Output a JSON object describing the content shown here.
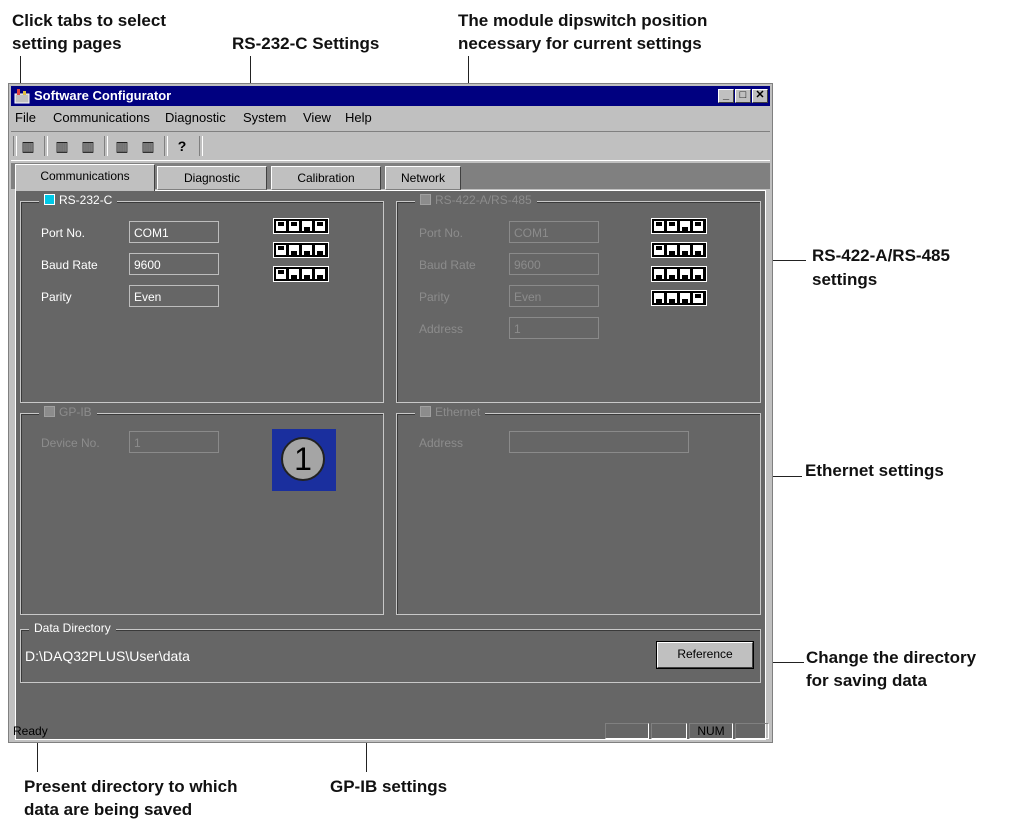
{
  "callouts": {
    "tabs_line1": "Click tabs to select",
    "tabs_line2": "setting pages",
    "rs232": "RS-232-C Settings",
    "dip_line1": "The module dipswitch position",
    "dip_line2": "necessary for current settings",
    "rs422_line1": "RS-422-A/RS-485",
    "rs422_line2": "settings",
    "ethernet": "Ethernet settings",
    "dir_line1": "Change the directory",
    "dir_line2": "for saving data",
    "present_line1": "Present directory to which",
    "present_line2": "data are being saved",
    "gpib": "GP-IB settings"
  },
  "window": {
    "title": "Software Configurator",
    "controls": {
      "minimize": "_",
      "maximize": "□",
      "close": "✕"
    }
  },
  "menu": [
    "File",
    "Communications",
    "Diagnostic",
    "System",
    "View",
    "Help"
  ],
  "toolbar": {
    "icons": [
      "factory-icon",
      "factory-settings-icon",
      "factory-new-icon",
      "upload-icon",
      "download-icon",
      "help-icon"
    ],
    "glyphs": [
      "▥",
      "▥",
      "▥",
      "▥",
      "▥",
      "?"
    ]
  },
  "tabs": [
    {
      "label": "Communications",
      "active": true
    },
    {
      "label": "Diagnostic",
      "active": false
    },
    {
      "label": "Calibration",
      "active": false
    },
    {
      "label": "Network",
      "active": false
    }
  ],
  "rs232": {
    "title": "RS-232-C",
    "enabled": true,
    "port_label": "Port No.",
    "port_value": "COM1",
    "baud_label": "Baud Rate",
    "baud_value": "9600",
    "parity_label": "Parity",
    "parity_value": "Even"
  },
  "rs422": {
    "title": "RS-422-A/RS-485",
    "enabled": false,
    "port_label": "Port No.",
    "port_value": "COM1",
    "baud_label": "Baud Rate",
    "baud_value": "9600",
    "parity_label": "Parity",
    "parity_value": "Even",
    "address_label": "Address",
    "address_value": "1"
  },
  "gpib": {
    "title": "GP-IB",
    "enabled": false,
    "device_label": "Device No.",
    "device_value": "1",
    "badge": "1"
  },
  "ethernet": {
    "title": "Ethernet",
    "enabled": false,
    "address_label": "Address",
    "address_value": ""
  },
  "data_directory": {
    "title": "Data Directory",
    "path": "D:\\DAQ32PLUS\\User\\data",
    "button": "Reference"
  },
  "status": {
    "text": "Ready",
    "num": "NUM"
  },
  "colors": {
    "checkbox_on": "#00c8e6",
    "checkbox_off": "#8c8c8c",
    "titlebar": "#000080",
    "panel": "#666666"
  }
}
